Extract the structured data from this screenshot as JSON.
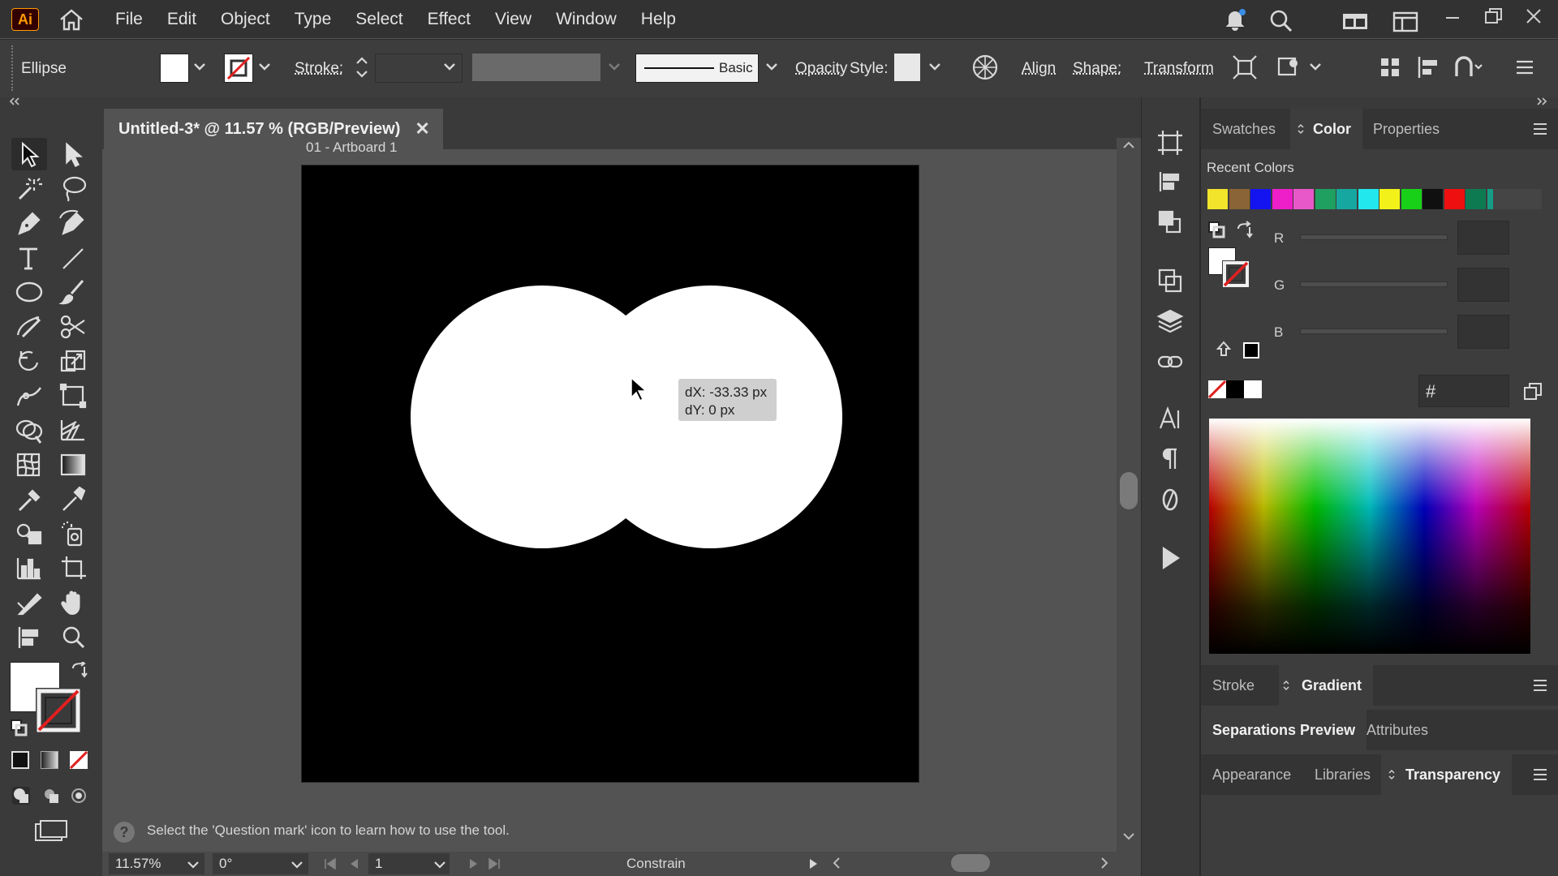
{
  "app": {
    "logo": "Ai",
    "menus": [
      "File",
      "Edit",
      "Object",
      "Type",
      "Select",
      "Effect",
      "View",
      "Window",
      "Help"
    ]
  },
  "control_bar": {
    "selection_type": "Ellipse",
    "stroke_label": "Stroke:",
    "brush_label": "Basic",
    "opacity_label": "Opacity",
    "style_label": "Style:",
    "align_label": "Align",
    "shape_label": "Shape:",
    "transform_label": "Transform"
  },
  "document": {
    "tab_title": "Untitled-3* @ 11.57 % (RGB/Preview)",
    "close_symbol": "✕",
    "artboard_label": "01 - Artboard 1"
  },
  "tooltip": {
    "dx": "dX: -33.33 px",
    "dy": "dY: 0 px"
  },
  "status": {
    "help_icon_text": "?",
    "hint": "Select the 'Question mark' icon to learn how to use the tool.",
    "zoom": "11.57%",
    "rotation": "0°",
    "artboard_number": "1",
    "mode": "Constrain"
  },
  "panel": {
    "top_tabs": [
      "Swatches",
      "Color",
      "Properties"
    ],
    "active_top_tab": "Color",
    "recent_colors_label": "Recent Colors",
    "recent_colors": [
      "#f2e42a",
      "#8a6436",
      "#1414f0",
      "#ee1ec8",
      "#e858c8",
      "#1fa060",
      "#16a8a0",
      "#22e8ee",
      "#f2f21a",
      "#18d018",
      "#101010",
      "#ee1010",
      "#0e7a52",
      "#169c84"
    ],
    "channels": [
      "R",
      "G",
      "B"
    ],
    "hex_symbol": "#",
    "stroke_tabs": [
      "Stroke",
      "Gradient"
    ],
    "sep_tabs": [
      "Separations Preview",
      "Attributes"
    ],
    "appearance_tabs": [
      "Appearance",
      "Libraries",
      "Transparency"
    ]
  },
  "colors": {
    "fill": "#ffffff",
    "stroke_none_slash": "#e02020"
  }
}
